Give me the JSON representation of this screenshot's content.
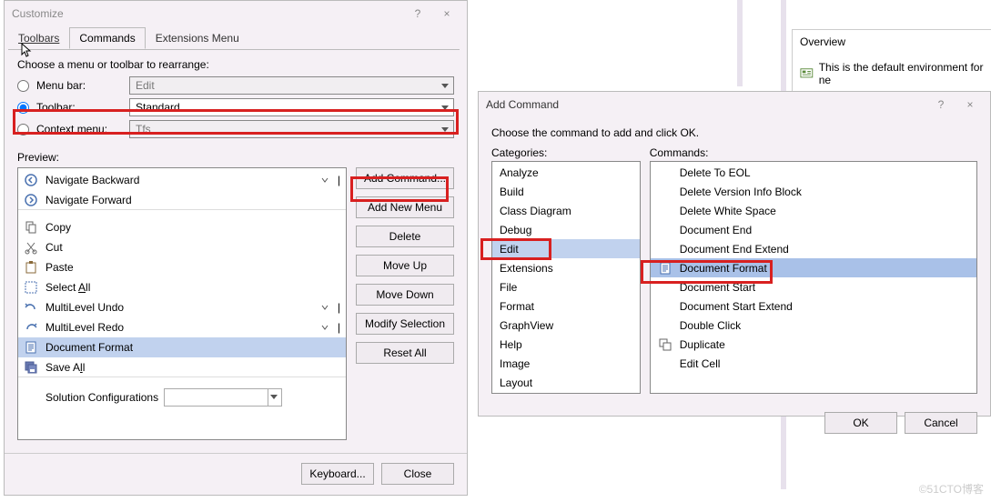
{
  "customize": {
    "title": "Customize",
    "help_char": "?",
    "close_char": "×",
    "tabs": {
      "toolbars": "Toolbars",
      "commands": "Commands",
      "extensions": "Extensions Menu"
    },
    "instruction": "Choose a menu or toolbar to rearrange:",
    "radios": {
      "menubar": "Menu bar:",
      "toolbar": "Toolbar:",
      "contextmenu": "Context menu:"
    },
    "combos": {
      "menubar": "Edit",
      "toolbar": "Standard",
      "contextmenu": "Tfs"
    },
    "preview_label": "Preview:",
    "preview_items": [
      {
        "id": "nav-back",
        "icon": "arrow-left-circle",
        "label": "Navigate Backward",
        "dropdown": true
      },
      {
        "id": "nav-fwd",
        "icon": "arrow-right-circle",
        "label": "Navigate Forward",
        "dropdown": false,
        "sep_after": true
      },
      {
        "id": "copy",
        "icon": "copy",
        "label": "Copy"
      },
      {
        "id": "cut",
        "icon": "cut",
        "label": "Cut"
      },
      {
        "id": "paste",
        "icon": "paste",
        "label": "Paste"
      },
      {
        "id": "select-all",
        "icon": "select-all",
        "label_html": "Select <u class='acc'>A</u>ll"
      },
      {
        "id": "undo",
        "icon": "undo",
        "label": "MultiLevel Undo",
        "dropdown": true
      },
      {
        "id": "redo",
        "icon": "redo",
        "label": "MultiLevel Redo",
        "dropdown": true
      },
      {
        "id": "doc-format",
        "icon": "doc",
        "label": "Document Format",
        "selected": true
      },
      {
        "id": "save-all",
        "icon": "save-all",
        "label_html": "Save A<u class='acc'>l</u>l",
        "sep_after": true
      },
      {
        "id": "sol-config",
        "combo": true,
        "label": "Solution Configurations"
      }
    ],
    "actions": {
      "add_command": "Add Command...",
      "add_new_menu": "Add New Menu",
      "delete": "Delete",
      "move_up": "Move Up",
      "move_down": "Move Down",
      "modify_selection": "Modify Selection",
      "reset_all": "Reset All"
    },
    "bottom": {
      "keyboard": "Keyboard...",
      "close": "Close"
    }
  },
  "addcmd": {
    "title": "Add Command",
    "help_char": "?",
    "close_char": "×",
    "instruction": "Choose the command to add and click OK.",
    "categories_label": "Categories:",
    "commands_label": "Commands:",
    "categories": [
      "Analyze",
      "Build",
      "Class Diagram",
      "Debug",
      "Edit",
      "Extensions",
      "File",
      "Format",
      "GraphView",
      "Help",
      "Image",
      "Layout"
    ],
    "selected_category": "Edit",
    "commands": [
      {
        "label": "Delete To EOL"
      },
      {
        "label": "Delete Version Info Block"
      },
      {
        "label": "Delete White Space"
      },
      {
        "label": "Document End"
      },
      {
        "label": "Document End Extend"
      },
      {
        "label": "Document Format",
        "icon": "doc",
        "selected": true
      },
      {
        "label": "Document Start"
      },
      {
        "label": "Document Start Extend"
      },
      {
        "label": "Double Click"
      },
      {
        "label": "Duplicate",
        "icon": "dup"
      },
      {
        "label": "Edit Cell"
      }
    ],
    "ok": "OK",
    "cancel": "Cancel"
  },
  "overview": {
    "title": "Overview",
    "text": "This is the default environment for ne"
  },
  "watermark": "©51CTO博客"
}
